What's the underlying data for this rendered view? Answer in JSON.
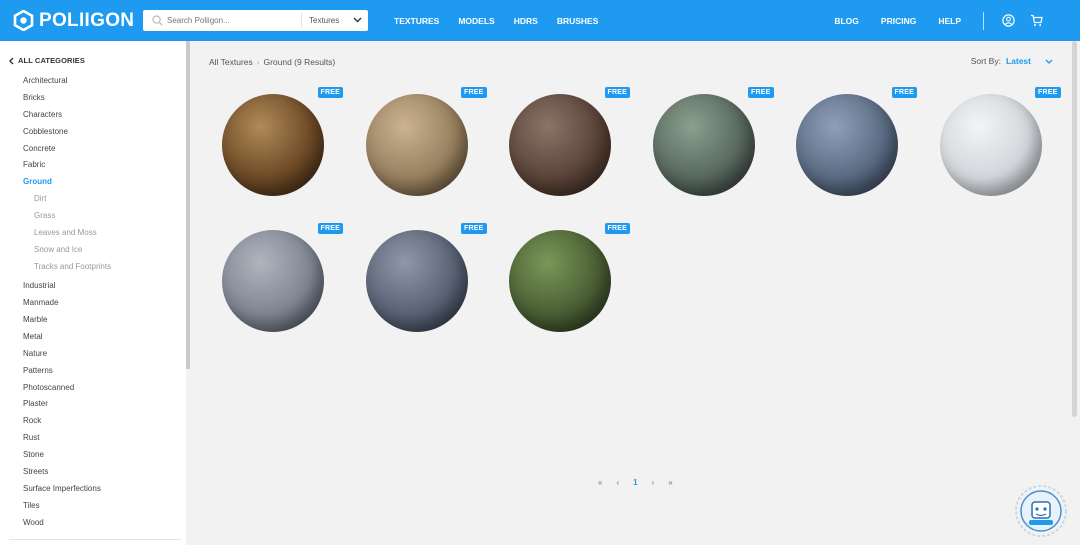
{
  "header": {
    "logo_text": "POLIIGON",
    "search_placeholder": "Search Poliigon...",
    "search_type": "Textures",
    "nav_left": [
      "TEXTURES",
      "MODELS",
      "HDRS",
      "BRUSHES"
    ],
    "nav_right": [
      "BLOG",
      "PRICING",
      "HELP"
    ],
    "icons": [
      "user-icon",
      "cart-icon"
    ],
    "accent_color": "#1e9bf0"
  },
  "sidebar": {
    "all_label": "ALL CATEGORIES",
    "categories": [
      {
        "label": "Architectural",
        "type": "top"
      },
      {
        "label": "Bricks",
        "type": "top"
      },
      {
        "label": "Characters",
        "type": "top"
      },
      {
        "label": "Cobblestone",
        "type": "top"
      },
      {
        "label": "Concrete",
        "type": "top"
      },
      {
        "label": "Fabric",
        "type": "top"
      },
      {
        "label": "Ground",
        "type": "active"
      },
      {
        "label": "Dirt",
        "type": "sub"
      },
      {
        "label": "Grass",
        "type": "sub"
      },
      {
        "label": "Leaves and Moss",
        "type": "sub"
      },
      {
        "label": "Snow and Ice",
        "type": "sub"
      },
      {
        "label": "Tracks and Footprints",
        "type": "sub"
      },
      {
        "label": "Industrial",
        "type": "top"
      },
      {
        "label": "Manmade",
        "type": "top"
      },
      {
        "label": "Marble",
        "type": "top"
      },
      {
        "label": "Metal",
        "type": "top"
      },
      {
        "label": "Nature",
        "type": "top"
      },
      {
        "label": "Patterns",
        "type": "top"
      },
      {
        "label": "Photoscanned",
        "type": "top"
      },
      {
        "label": "Plaster",
        "type": "top"
      },
      {
        "label": "Rock",
        "type": "top"
      },
      {
        "label": "Rust",
        "type": "top"
      },
      {
        "label": "Stone",
        "type": "top"
      },
      {
        "label": "Streets",
        "type": "top"
      },
      {
        "label": "Surface Imperfections",
        "type": "top"
      },
      {
        "label": "Tiles",
        "type": "top"
      },
      {
        "label": "Wood",
        "type": "top"
      }
    ]
  },
  "main": {
    "breadcrumb": {
      "root": "All Textures",
      "separator": "›",
      "current": "Ground (9 Results)"
    },
    "sort": {
      "label": "Sort By:",
      "value": "Latest"
    },
    "textures": [
      {
        "badge": "FREE",
        "colors": [
          "#b08a58",
          "#6d4a26",
          "#2a1a0c"
        ]
      },
      {
        "badge": "FREE",
        "colors": [
          "#cbb392",
          "#97805f",
          "#4a3a26"
        ]
      },
      {
        "badge": "FREE",
        "colors": [
          "#8a7468",
          "#5a4338",
          "#2a1c16"
        ]
      },
      {
        "badge": "FREE",
        "colors": [
          "#8aa08e",
          "#58685e",
          "#22292a"
        ]
      },
      {
        "badge": "FREE",
        "colors": [
          "#8ea0b8",
          "#5a6a82",
          "#26303e"
        ]
      },
      {
        "badge": "FREE",
        "colors": [
          "#f2f4f6",
          "#d2d6da",
          "#8c949c"
        ]
      },
      {
        "badge": "FREE",
        "colors": [
          "#b0b4be",
          "#7e8592",
          "#3a3e48"
        ]
      },
      {
        "badge": "FREE",
        "colors": [
          "#8e98a8",
          "#586274",
          "#232a36"
        ]
      },
      {
        "badge": "FREE",
        "colors": [
          "#7a9858",
          "#4a5e34",
          "#1e2814"
        ]
      }
    ],
    "pagination": {
      "first": "«",
      "prev": "‹",
      "current": "1",
      "next": "›",
      "last": "»"
    }
  }
}
